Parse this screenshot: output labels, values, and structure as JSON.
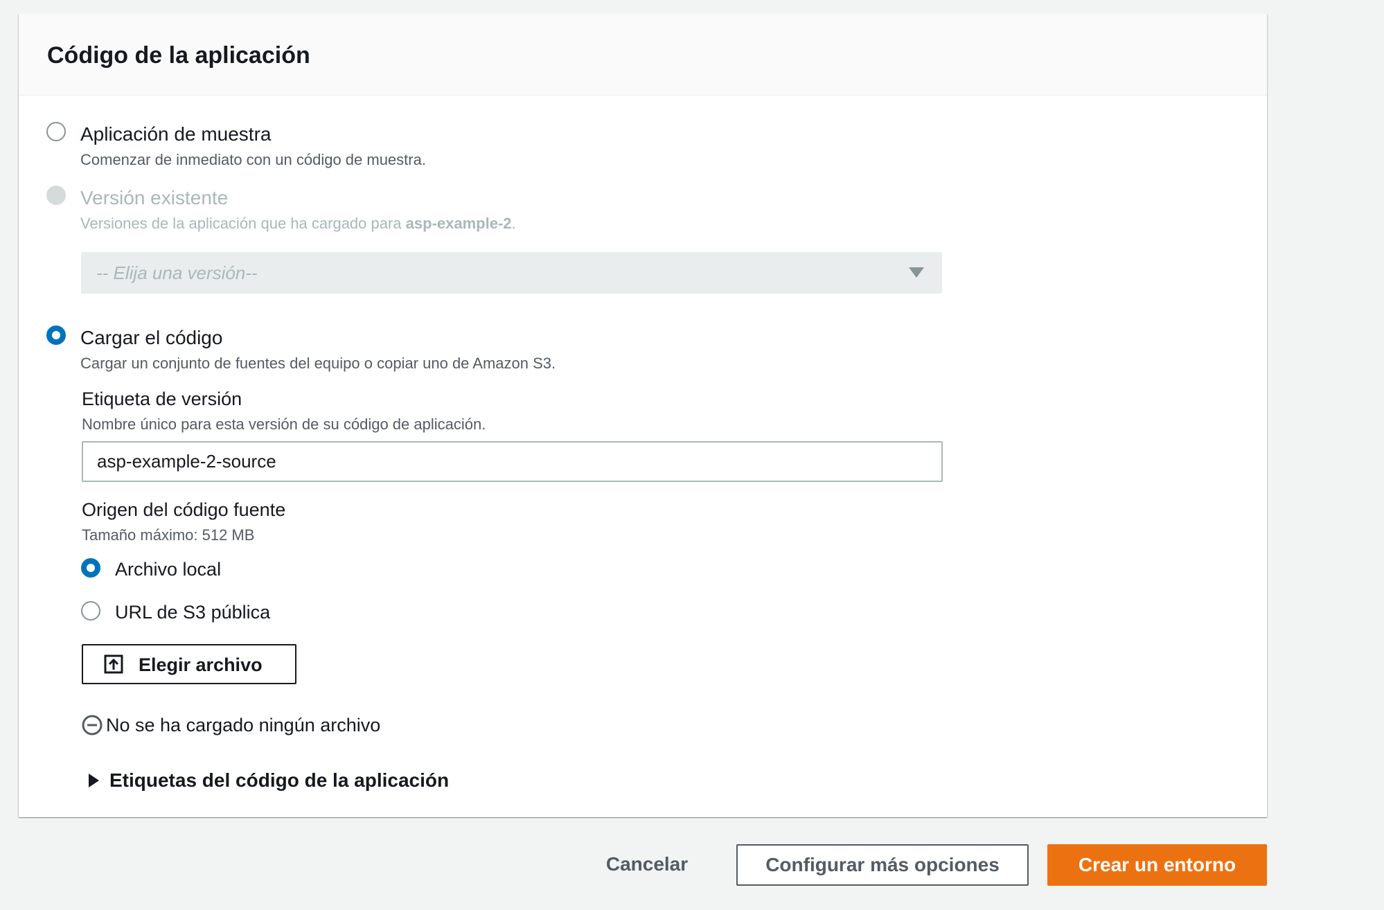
{
  "section": {
    "title": "Código de la aplicación"
  },
  "options": {
    "sample": {
      "label": "Aplicación de muestra",
      "description": "Comenzar de inmediato con un código de muestra.",
      "selected": false
    },
    "existing": {
      "label": "Versión existente",
      "description_prefix": "Versiones de la aplicación que ha cargado para ",
      "description_app": "asp-example-2",
      "description_suffix": ".",
      "disabled": true,
      "select_placeholder": "-- Elija una versión--"
    },
    "upload": {
      "label": "Cargar el código",
      "description": "Cargar un conjunto de fuentes del equipo o copiar uno de Amazon S3.",
      "selected": true
    }
  },
  "version_label": {
    "label": "Etiqueta de versión",
    "description": "Nombre único para esta versión de su código de aplicación.",
    "value": "asp-example-2-source"
  },
  "source_origin": {
    "label": "Origen del código fuente",
    "description": "Tamaño máximo: 512 MB",
    "choices": [
      {
        "label": "Archivo local",
        "selected": true
      },
      {
        "label": "URL de S3 pública",
        "selected": false
      }
    ],
    "choose_button": "Elegir archivo",
    "choose_icon": "upload-icon",
    "status_icon": "minus-circle-icon",
    "status_text": "No se ha cargado ningún archivo"
  },
  "tags_expander": {
    "label": "Etiquetas del código de la aplicación",
    "expanded": false
  },
  "footer": {
    "cancel": "Cancelar",
    "configure_more": "Configurar más opciones",
    "create": "Crear un entorno"
  },
  "colors": {
    "accent": "#0073bb",
    "primary_button": "#ec7211",
    "background": "#f2f3f3"
  }
}
